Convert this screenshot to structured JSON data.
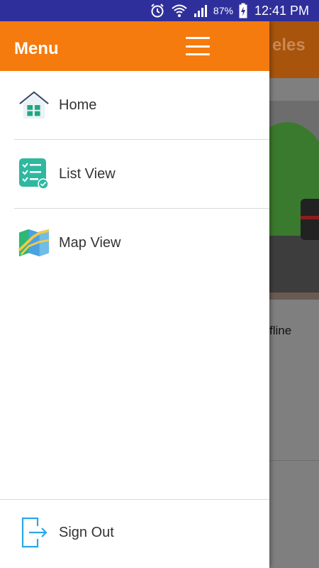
{
  "status_bar": {
    "battery_percent": "87%",
    "time": "12:41 PM",
    "icons": [
      "alarm-icon",
      "wifi-icon",
      "signal-icon",
      "battery-charging-icon"
    ],
    "background_color": "#2f2f9c"
  },
  "drawer": {
    "title": "Menu",
    "header_color": "#f57b0e",
    "items": [
      {
        "label": "Home",
        "icon": "home-icon"
      },
      {
        "label": "List View",
        "icon": "checklist-icon"
      },
      {
        "label": "Map View",
        "icon": "map-icon"
      }
    ],
    "footer": {
      "label": "Sign Out",
      "icon": "sign-out-icon"
    }
  },
  "background_screen": {
    "title_fragment": "eles",
    "status_fragment": "fline",
    "header_color": "#a8540c"
  }
}
